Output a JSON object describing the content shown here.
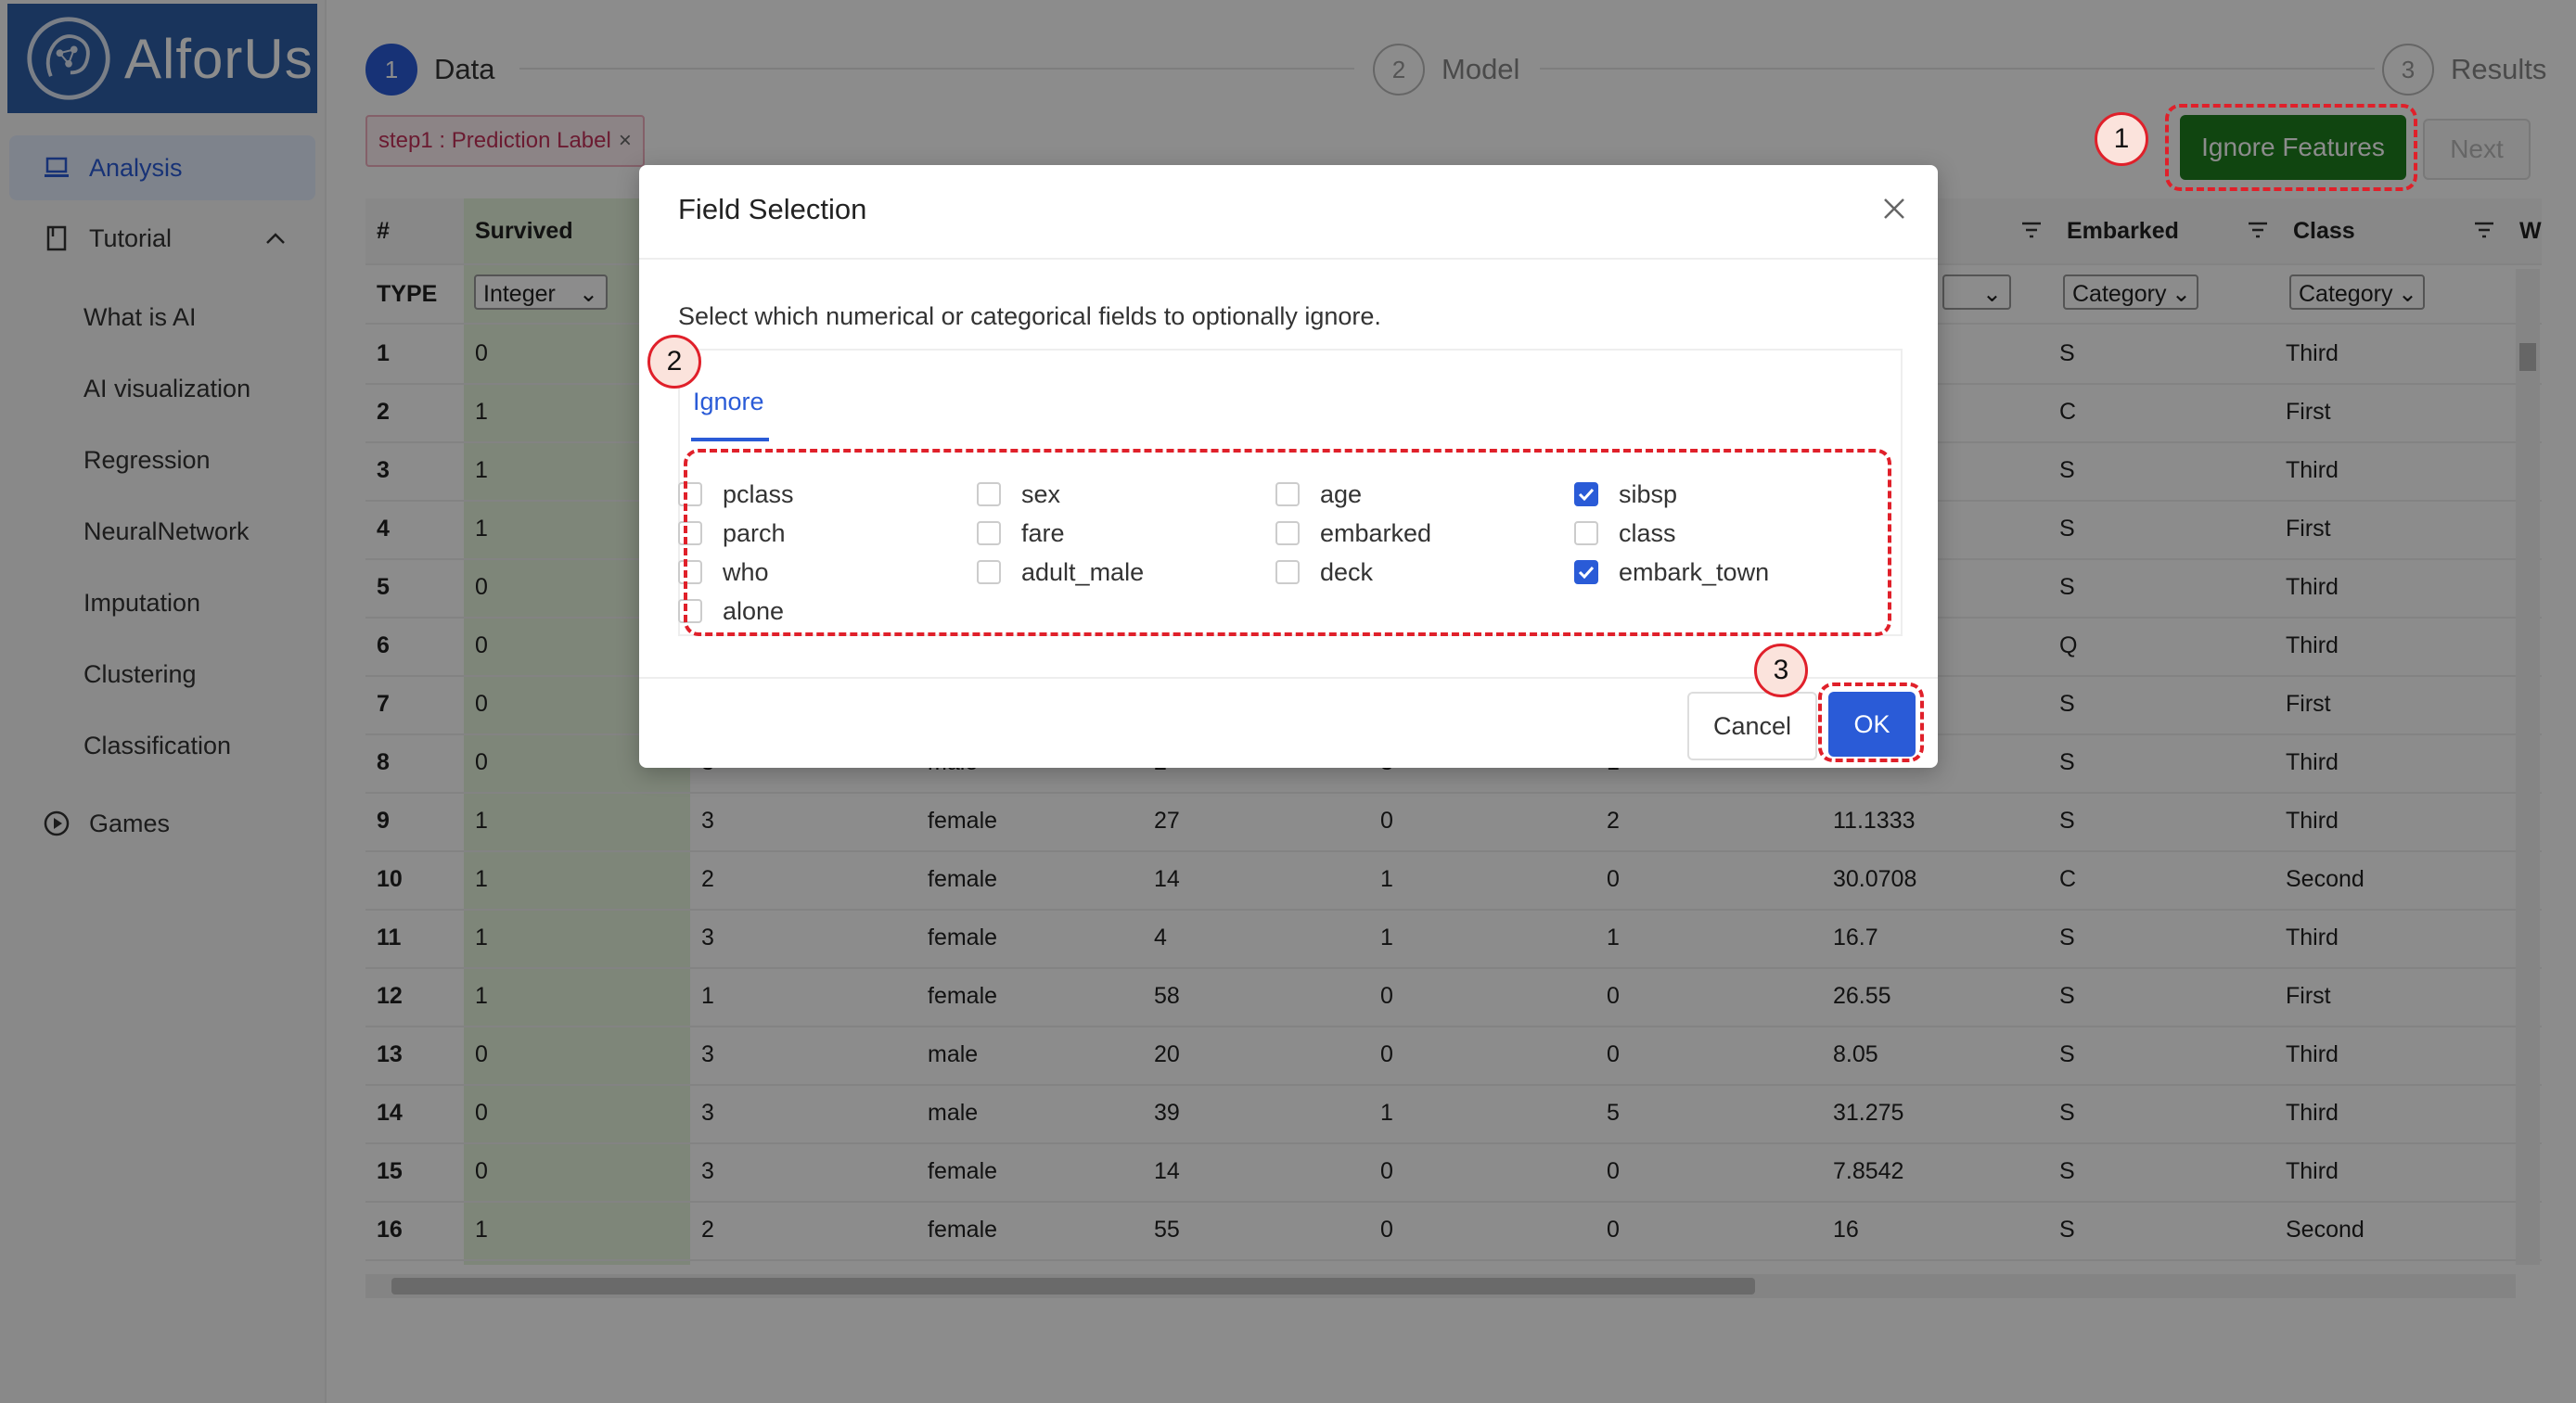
{
  "app": {
    "name": "AlforUs"
  },
  "sidebar": {
    "items": [
      {
        "label": "Analysis",
        "icon": "laptop-icon"
      },
      {
        "label": "Tutorial",
        "icon": "book-icon"
      },
      {
        "label": "Games",
        "icon": "play-circle-icon"
      }
    ],
    "tutorial_children": [
      "What is AI",
      "AI visualization",
      "Regression",
      "NeuralNetwork",
      "Imputation",
      "Clustering",
      "Classification"
    ]
  },
  "steps": [
    {
      "num": "1",
      "label": "Data"
    },
    {
      "num": "2",
      "label": "Model"
    },
    {
      "num": "3",
      "label": "Results"
    }
  ],
  "tag": {
    "label": "step1 : Prediction Label",
    "close": "×"
  },
  "toolbar": {
    "ignore_label": "Ignore Features",
    "next_label": "Next"
  },
  "table": {
    "headers": [
      "#",
      "Survived",
      "Embarked",
      "Class",
      "W"
    ],
    "type_row": {
      "label": "TYPE",
      "survived": "Integer",
      "hidden_col": "",
      "embarked": "Category",
      "class": "Category"
    },
    "rows": [
      [
        "1",
        "0",
        "",
        "",
        "",
        "",
        "",
        "",
        "S",
        "Third"
      ],
      [
        "2",
        "1",
        "",
        "",
        "",
        "",
        "",
        "",
        "C",
        "First"
      ],
      [
        "3",
        "1",
        "",
        "",
        "",
        "",
        "",
        "",
        "S",
        "Third"
      ],
      [
        "4",
        "1",
        "",
        "",
        "",
        "",
        "",
        "",
        "S",
        "First"
      ],
      [
        "5",
        "0",
        "",
        "",
        "",
        "",
        "",
        "",
        "S",
        "Third"
      ],
      [
        "6",
        "0",
        "",
        "",
        "",
        "",
        "",
        "",
        "Q",
        "Third"
      ],
      [
        "7",
        "0",
        "",
        "",
        "",
        "",
        "",
        "",
        "S",
        "First"
      ],
      [
        "8",
        "0",
        "3",
        "male",
        "2",
        "3",
        "1",
        "",
        "S",
        "Third"
      ],
      [
        "9",
        "1",
        "3",
        "female",
        "27",
        "0",
        "2",
        "11.1333",
        "S",
        "Third"
      ],
      [
        "10",
        "1",
        "2",
        "female",
        "14",
        "1",
        "0",
        "30.0708",
        "C",
        "Second"
      ],
      [
        "11",
        "1",
        "3",
        "female",
        "4",
        "1",
        "1",
        "16.7",
        "S",
        "Third"
      ],
      [
        "12",
        "1",
        "1",
        "female",
        "58",
        "0",
        "0",
        "26.55",
        "S",
        "First"
      ],
      [
        "13",
        "0",
        "3",
        "male",
        "20",
        "0",
        "0",
        "8.05",
        "S",
        "Third"
      ],
      [
        "14",
        "0",
        "3",
        "male",
        "39",
        "1",
        "5",
        "31.275",
        "S",
        "Third"
      ],
      [
        "15",
        "0",
        "3",
        "female",
        "14",
        "0",
        "0",
        "7.8542",
        "S",
        "Third"
      ],
      [
        "16",
        "1",
        "2",
        "female",
        "55",
        "0",
        "0",
        "16",
        "S",
        "Second"
      ]
    ]
  },
  "modal": {
    "title": "Field Selection",
    "description": "Select which numerical or categorical fields to optionally ignore.",
    "tab": "Ignore",
    "fields": [
      {
        "label": "pclass",
        "checked": false
      },
      {
        "label": "sex",
        "checked": false
      },
      {
        "label": "age",
        "checked": false
      },
      {
        "label": "sibsp",
        "checked": true
      },
      {
        "label": "parch",
        "checked": false
      },
      {
        "label": "fare",
        "checked": false
      },
      {
        "label": "embarked",
        "checked": false
      },
      {
        "label": "class",
        "checked": false
      },
      {
        "label": "who",
        "checked": false
      },
      {
        "label": "adult_male",
        "checked": false
      },
      {
        "label": "deck",
        "checked": false
      },
      {
        "label": "embark_town",
        "checked": true
      },
      {
        "label": "alone",
        "checked": false
      }
    ],
    "cancel_label": "Cancel",
    "ok_label": "OK"
  },
  "annotations": [
    "1",
    "2",
    "3"
  ],
  "colors": {
    "accent": "#2a5bd7",
    "ignore_button": "#1e7e1e",
    "annotation_red": "#e0202a"
  }
}
